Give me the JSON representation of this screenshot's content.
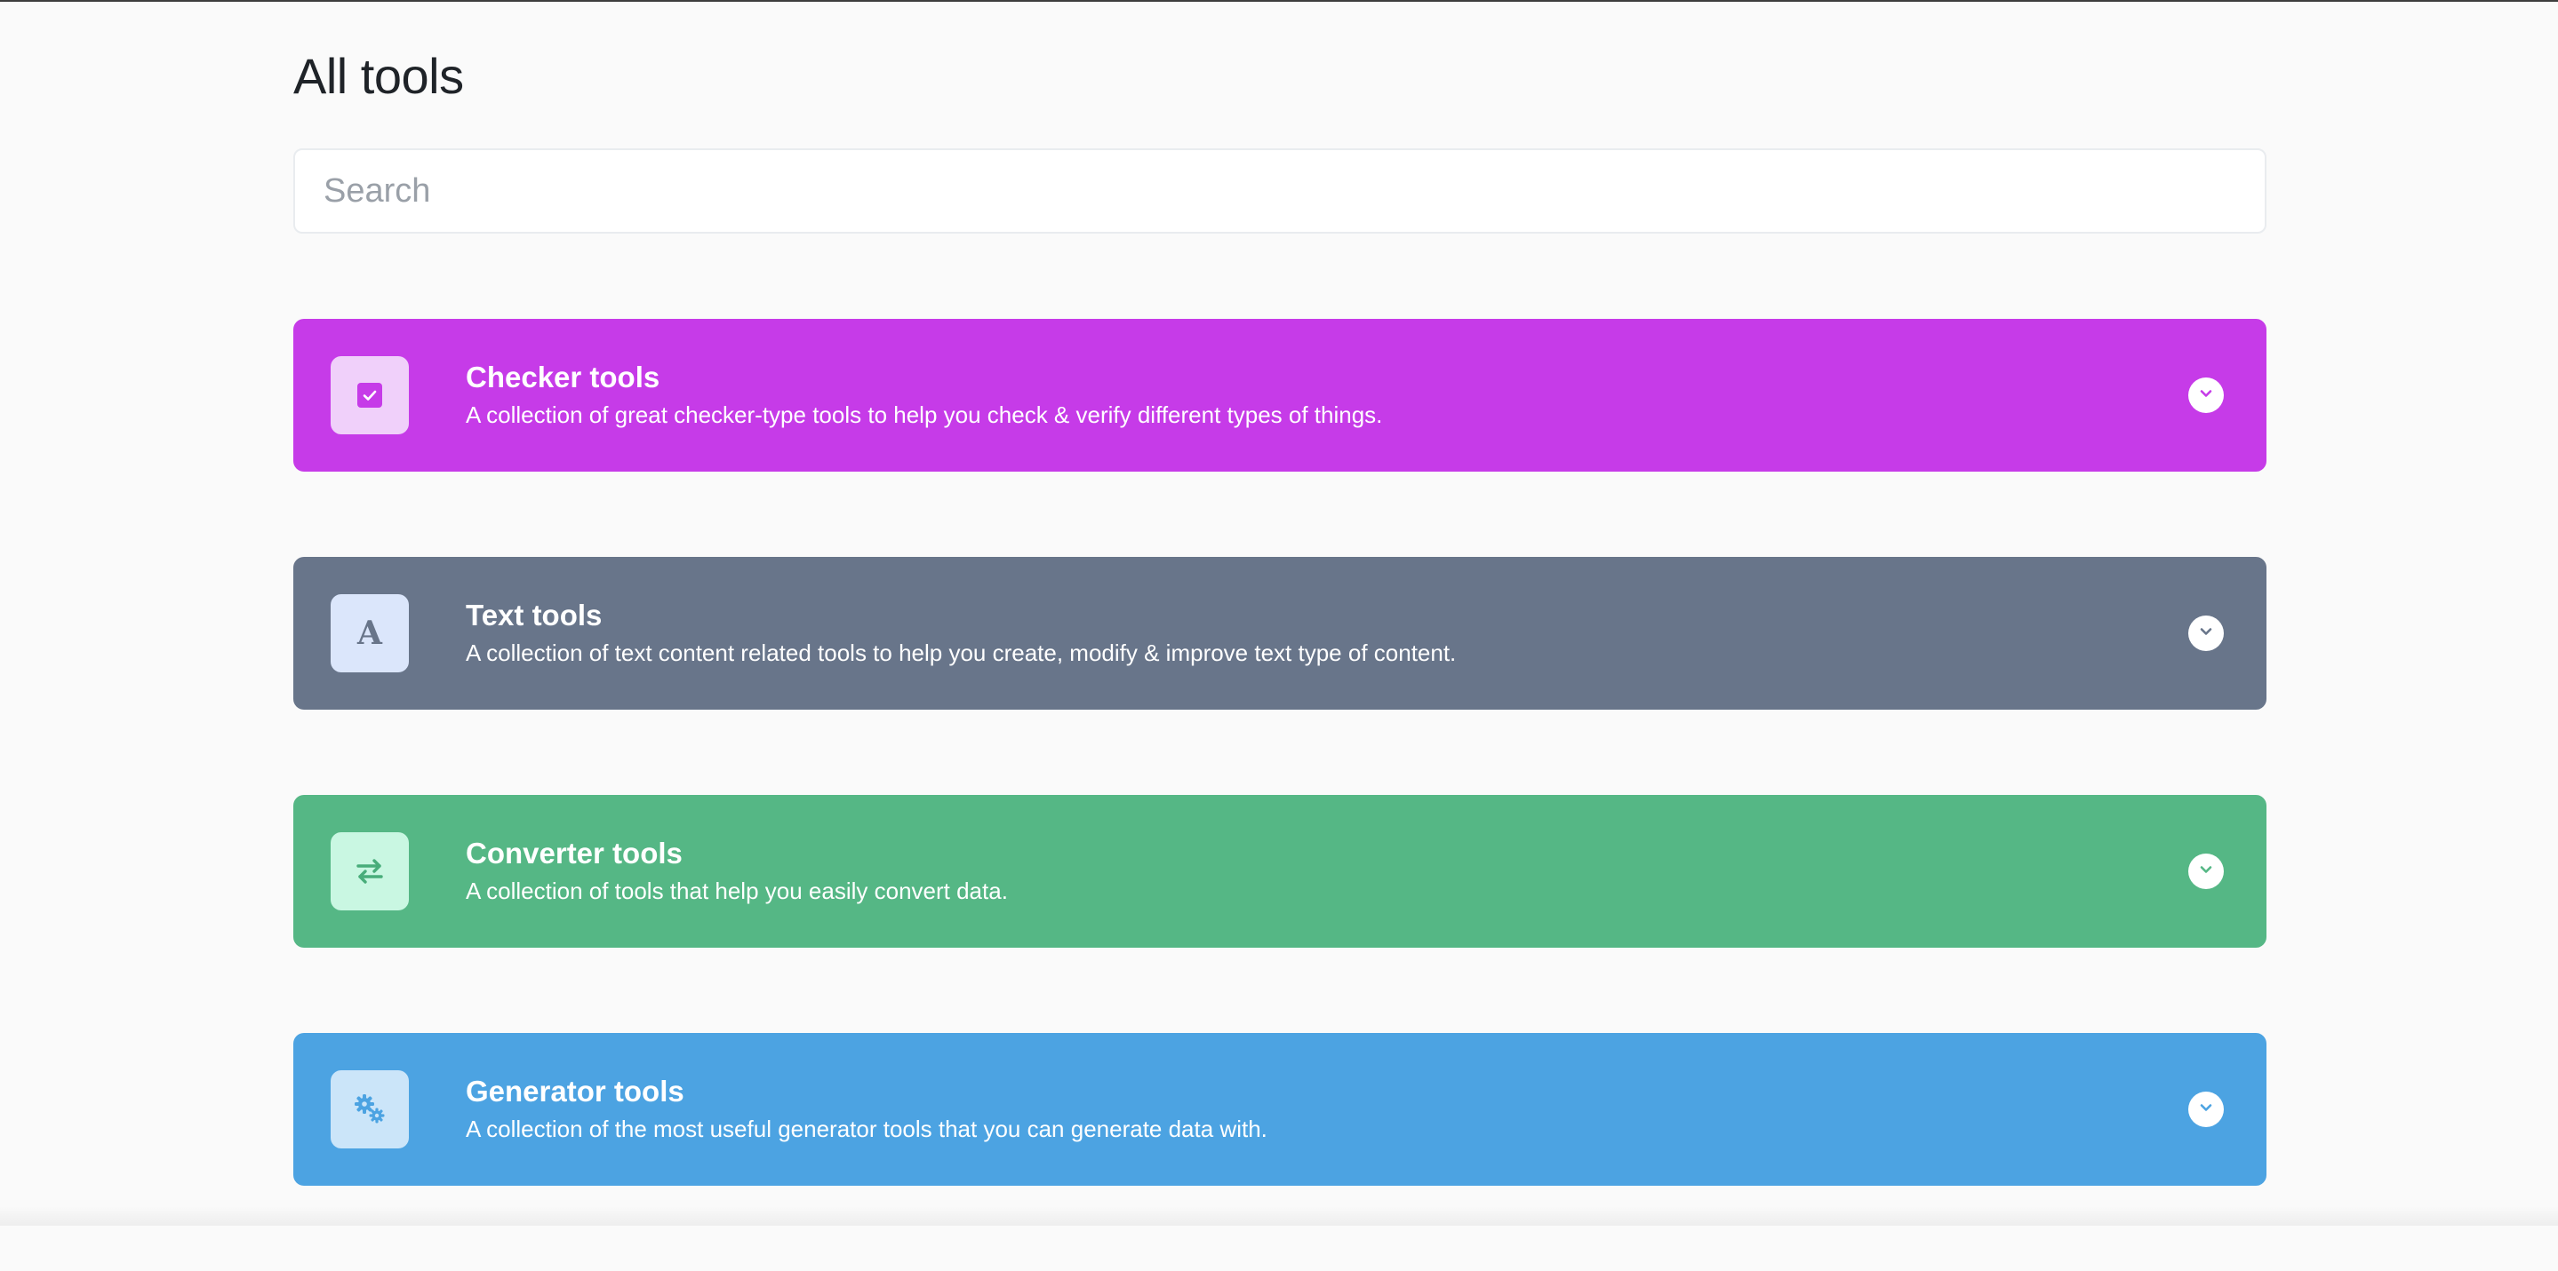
{
  "page": {
    "title": "All tools"
  },
  "search": {
    "placeholder": "Search",
    "value": ""
  },
  "categories": [
    {
      "title": "Checker tools",
      "description": "A collection of great checker-type tools to help you check & verify different types of things.",
      "icon": "checkbox-icon",
      "color": "#c63be8",
      "icon_bg": "#f0d0fa",
      "icon_fg": "#c63be8"
    },
    {
      "title": "Text tools",
      "description": "A collection of text content related tools to help you create, modify & improve text type of content.",
      "icon": "letter-a-icon",
      "icon_glyph": "A",
      "color": "#68758a",
      "icon_bg": "#dbe6fb",
      "icon_fg": "#68758a"
    },
    {
      "title": "Converter tools",
      "description": "A collection of tools that help you easily convert data.",
      "icon": "arrows-exchange-icon",
      "color": "#55b785",
      "icon_bg": "#c9f7e2",
      "icon_fg": "#48ad7a"
    },
    {
      "title": "Generator tools",
      "description": "A collection of the most useful generator tools that you can generate data with.",
      "icon": "cogs-icon",
      "color": "#4ca3e2",
      "icon_bg": "#cbe5f9",
      "icon_fg": "#4ca3e2"
    }
  ]
}
